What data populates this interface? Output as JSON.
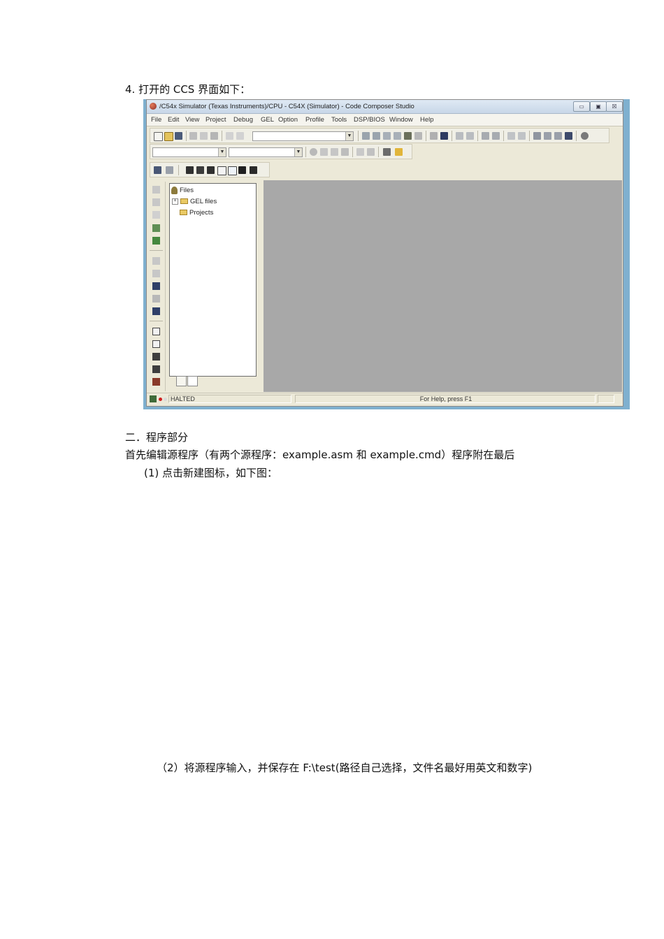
{
  "doc": {
    "item4": "4.    打开的 CCS 界面如下：",
    "section2": "二．程序部分",
    "intro": "首先编辑源程序（有两个源程序：example.asm 和 example.cmd）程序附在最后",
    "step1": "(1)  点击新建图标，如下图：",
    "step2": "（2）将源程序输入，并保存在 F:\\test(路径自己选择，文件名最好用英文和数字)"
  },
  "ccs": {
    "title": "/C54x Simulator (Texas Instruments)/CPU - C54X (Simulator) - Code Composer Studio",
    "window_buttons": [
      "▭",
      "▣",
      "☒"
    ],
    "menu": [
      "File",
      "Edit",
      "View",
      "Project",
      "Debug",
      "GEL",
      "Option",
      "Profile",
      "Tools",
      "DSP/BIOS",
      "Window",
      "Help"
    ],
    "tree": {
      "root": "Files",
      "items": [
        "GEL files",
        "Projects"
      ]
    },
    "status": {
      "state": "HALTED",
      "help": "For Help, press F1"
    },
    "icons": {
      "app": "ccs-app-icon",
      "root": "workspace-icon",
      "folder": "folder-icon"
    }
  }
}
